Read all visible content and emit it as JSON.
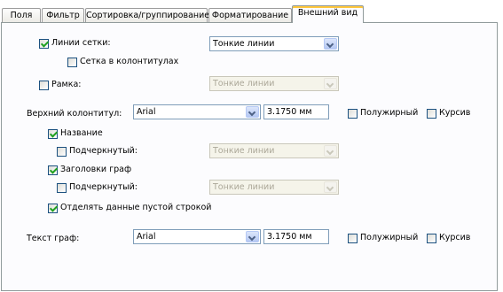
{
  "tabs": [
    {
      "label": "Поля"
    },
    {
      "label": "Фильтр"
    },
    {
      "label": "Сортировка/группирование"
    },
    {
      "label": "Форматирование"
    },
    {
      "label": "Внешний вид"
    }
  ],
  "active_tab": "Внешний вид",
  "gridlines": {
    "label": "Линии сетки:",
    "checked": true,
    "style_value": "Тонкие линии"
  },
  "grid_in_headers": {
    "label": "Сетка в колонтитулах",
    "checked": false
  },
  "border": {
    "label": "Рамка:",
    "checked": false,
    "style_value": "Тонкие линии"
  },
  "header": {
    "label": "Верхний колонтитул:",
    "font": "Arial",
    "size": "3.1750 мм",
    "bold_label": "Полужирный",
    "italic_label": "Курсив"
  },
  "title": {
    "label": "Название",
    "checked": true
  },
  "title_underline": {
    "label": "Подчеркнутый:",
    "checked": false,
    "style_value": "Тонкие линии"
  },
  "column_headers": {
    "label": "Заголовки граф",
    "checked": true
  },
  "column_underline": {
    "label": "Подчеркнутый:",
    "checked": false,
    "style_value": "Тонкие линии"
  },
  "separate_blank": {
    "label": "Отделять данные пустой строкой",
    "checked": true
  },
  "column_text": {
    "label": "Текст граф:",
    "font": "Arial",
    "size": "3.1750 мм",
    "bold_label": "Полужирный",
    "italic_label": "Курсив"
  },
  "colors": {
    "accent_tab": "#ffc73c",
    "check": "#21a121",
    "border": "#7f9db9"
  }
}
